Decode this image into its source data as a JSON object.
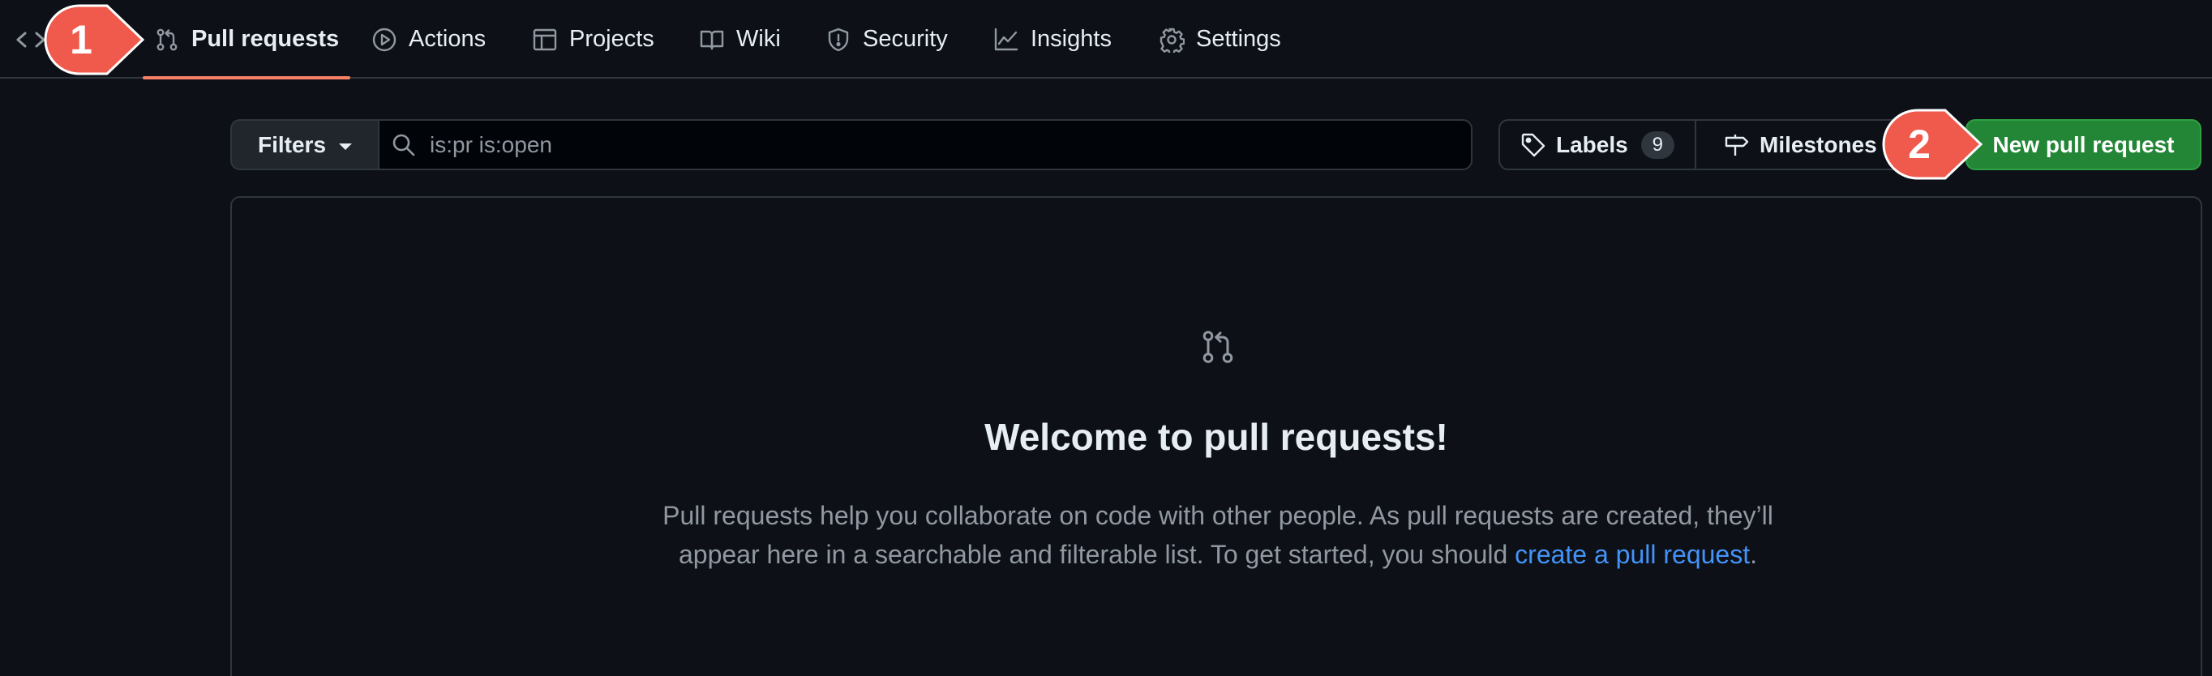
{
  "nav": {
    "code_icon": "code-icon",
    "items": [
      {
        "label": "Pull requests",
        "icon": "git-pull-request-icon",
        "selected": true
      },
      {
        "label": "Actions",
        "icon": "play-icon"
      },
      {
        "label": "Projects",
        "icon": "table-icon"
      },
      {
        "label": "Wiki",
        "icon": "book-icon"
      },
      {
        "label": "Security",
        "icon": "shield-icon"
      },
      {
        "label": "Insights",
        "icon": "graph-icon"
      },
      {
        "label": "Settings",
        "icon": "gear-icon"
      }
    ]
  },
  "markers": [
    {
      "number": "1",
      "color": "#ef5a4c"
    },
    {
      "number": "2",
      "color": "#ef5a4c"
    }
  ],
  "filter_bar": {
    "filters_label": "Filters",
    "search_value": "is:pr is:open",
    "labels_label": "Labels",
    "labels_count": "9",
    "milestones_label": "Milestones",
    "new_pr_label": "New pull request"
  },
  "blankslate": {
    "title": "Welcome to pull requests!",
    "description_prefix": "Pull requests help you collaborate on code with other people. As pull requests are created, they’ll appear here in a searchable and filterable list. To get started, you should ",
    "link_text": "create a pull request",
    "description_suffix": "."
  },
  "colors": {
    "background": "#0d1117",
    "border": "#30363d",
    "accent_underline": "#f78166",
    "primary_button": "#238636",
    "link": "#4493f8",
    "marker": "#ef5a4c"
  }
}
